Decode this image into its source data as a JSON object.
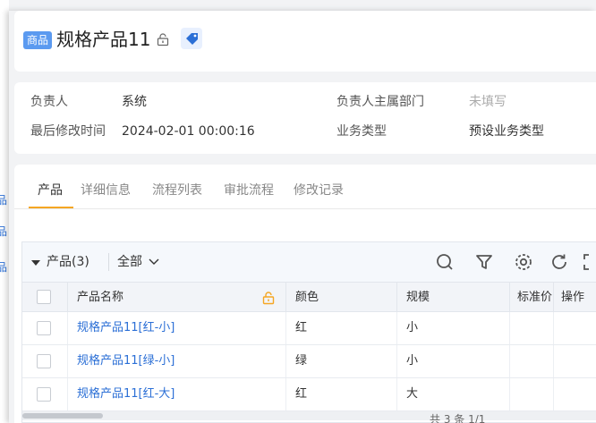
{
  "header": {
    "tag": "商品",
    "title": "规格产品11",
    "icons": [
      "lock-icon",
      "price-tag-icon"
    ]
  },
  "info": {
    "owner_label": "负责人",
    "owner_value": "系统",
    "dept_label": "负责人主属部门",
    "dept_value": "未填写",
    "modified_label": "最后修改时间",
    "modified_value": "2024-02-01 00:00:16",
    "biz_type_label": "业务类型",
    "biz_type_value": "预设业务类型"
  },
  "tabs": [
    "产品",
    "详细信息",
    "流程列表",
    "审批流程",
    "修改记录"
  ],
  "active_tab": "产品",
  "table": {
    "toolbar_title": "产品(3)",
    "filter_value": "全部",
    "toolbar_icons": [
      "search-icon",
      "filter-icon",
      "settings-icon",
      "refresh-icon",
      "fullscreen-icon"
    ],
    "columns": [
      "产品名称",
      "颜色",
      "规模",
      "标准价",
      "操作"
    ],
    "rows": [
      {
        "name": "规格产品11[红-小]",
        "color": "红",
        "size": "小"
      },
      {
        "name": "规格产品11[绿-小]",
        "color": "绿",
        "size": "小"
      },
      {
        "name": "规格产品11[红-大]",
        "color": "红",
        "size": "大"
      }
    ]
  },
  "footer": {
    "summary": "共 3 条  1/1"
  },
  "colors": {
    "accent": "#f5a623",
    "tag_bg": "#5b9af0",
    "link": "#2b6fd6"
  }
}
